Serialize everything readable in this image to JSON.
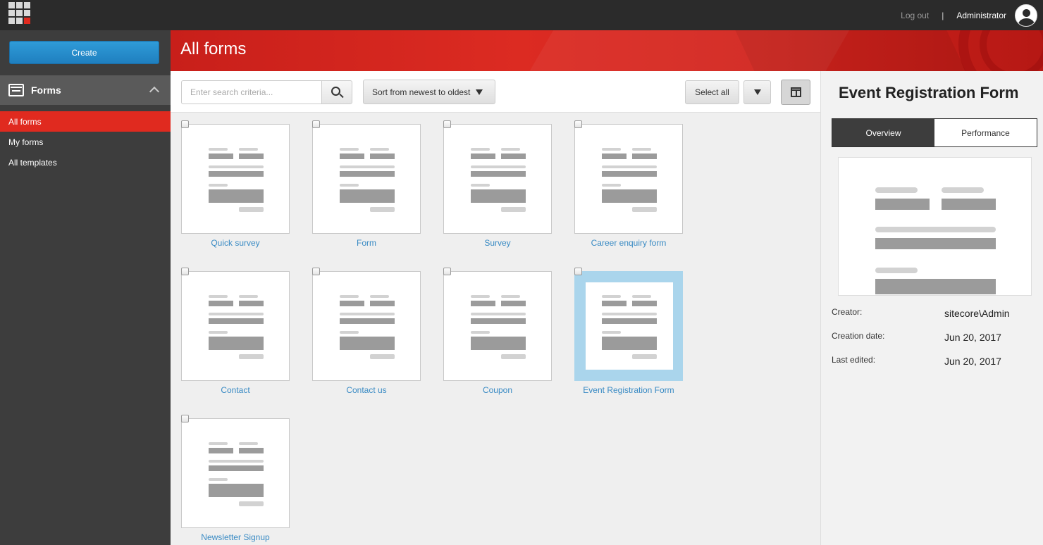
{
  "topbar": {
    "logout_label": "Log out",
    "separator": "|",
    "user_name": "Administrator"
  },
  "sidebar": {
    "create_label": "Create",
    "section_title": "Forms",
    "items": [
      {
        "label": "All forms",
        "active": true
      },
      {
        "label": "My forms",
        "active": false
      },
      {
        "label": "All templates",
        "active": false
      }
    ]
  },
  "header": {
    "title": "All forms"
  },
  "toolbar": {
    "search_placeholder": "Enter search criteria...",
    "sort_label": "Sort from newest to oldest",
    "select_all_label": "Select all"
  },
  "forms": [
    {
      "name": "Quick survey",
      "selected": false
    },
    {
      "name": "Form",
      "selected": false
    },
    {
      "name": "Survey",
      "selected": false
    },
    {
      "name": "Career enquiry form",
      "selected": false
    },
    {
      "name": "Contact",
      "selected": false
    },
    {
      "name": "Contact us",
      "selected": false
    },
    {
      "name": "Coupon",
      "selected": false
    },
    {
      "name": "Event Registration Form",
      "selected": true
    },
    {
      "name": "Newsletter Signup",
      "selected": false
    }
  ],
  "details": {
    "title": "Event Registration Form",
    "tabs": [
      "Overview",
      "Performance"
    ],
    "active_tab": "Overview",
    "creator_label": "Creator:",
    "creator": "sitecore\\Admin",
    "creation_date_label": "Creation date:",
    "creation_date": "Jun 20, 2017",
    "last_edited_label": "Last edited:",
    "last_edited": "Jun 20, 2017"
  },
  "colors": {
    "accent_red": "#e02a1f",
    "create_blue": "#1f7fbf",
    "link_blue": "#3a8bc4",
    "selection_blue": "#aad5ec"
  }
}
